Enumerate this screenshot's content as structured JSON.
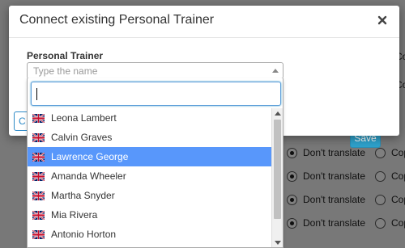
{
  "modal": {
    "title": "Connect existing Personal Trainer",
    "close_icon": "close-icon",
    "field_label": "Personal Trainer",
    "select_placeholder": "Type the name",
    "cancel_label": "C",
    "save_label": "Save"
  },
  "dropdown": {
    "search_value": "",
    "flag_icon": "uk-flag-icon",
    "highlighted_index": 2,
    "options": [
      {
        "label": "Leona Lambert"
      },
      {
        "label": "Calvin Graves"
      },
      {
        "label": "Lawrence George"
      },
      {
        "label": "Amanda Wheeler"
      },
      {
        "label": "Martha Snyder"
      },
      {
        "label": "Mia Rivera"
      },
      {
        "label": "Antonio Horton"
      }
    ]
  },
  "background": {
    "dont_translate_label": "Don't translate",
    "copy_label": "Copy",
    "partial_copy_label": "Copy"
  },
  "colors": {
    "primary": "#2ea2cc",
    "highlight": "#5897fb"
  }
}
